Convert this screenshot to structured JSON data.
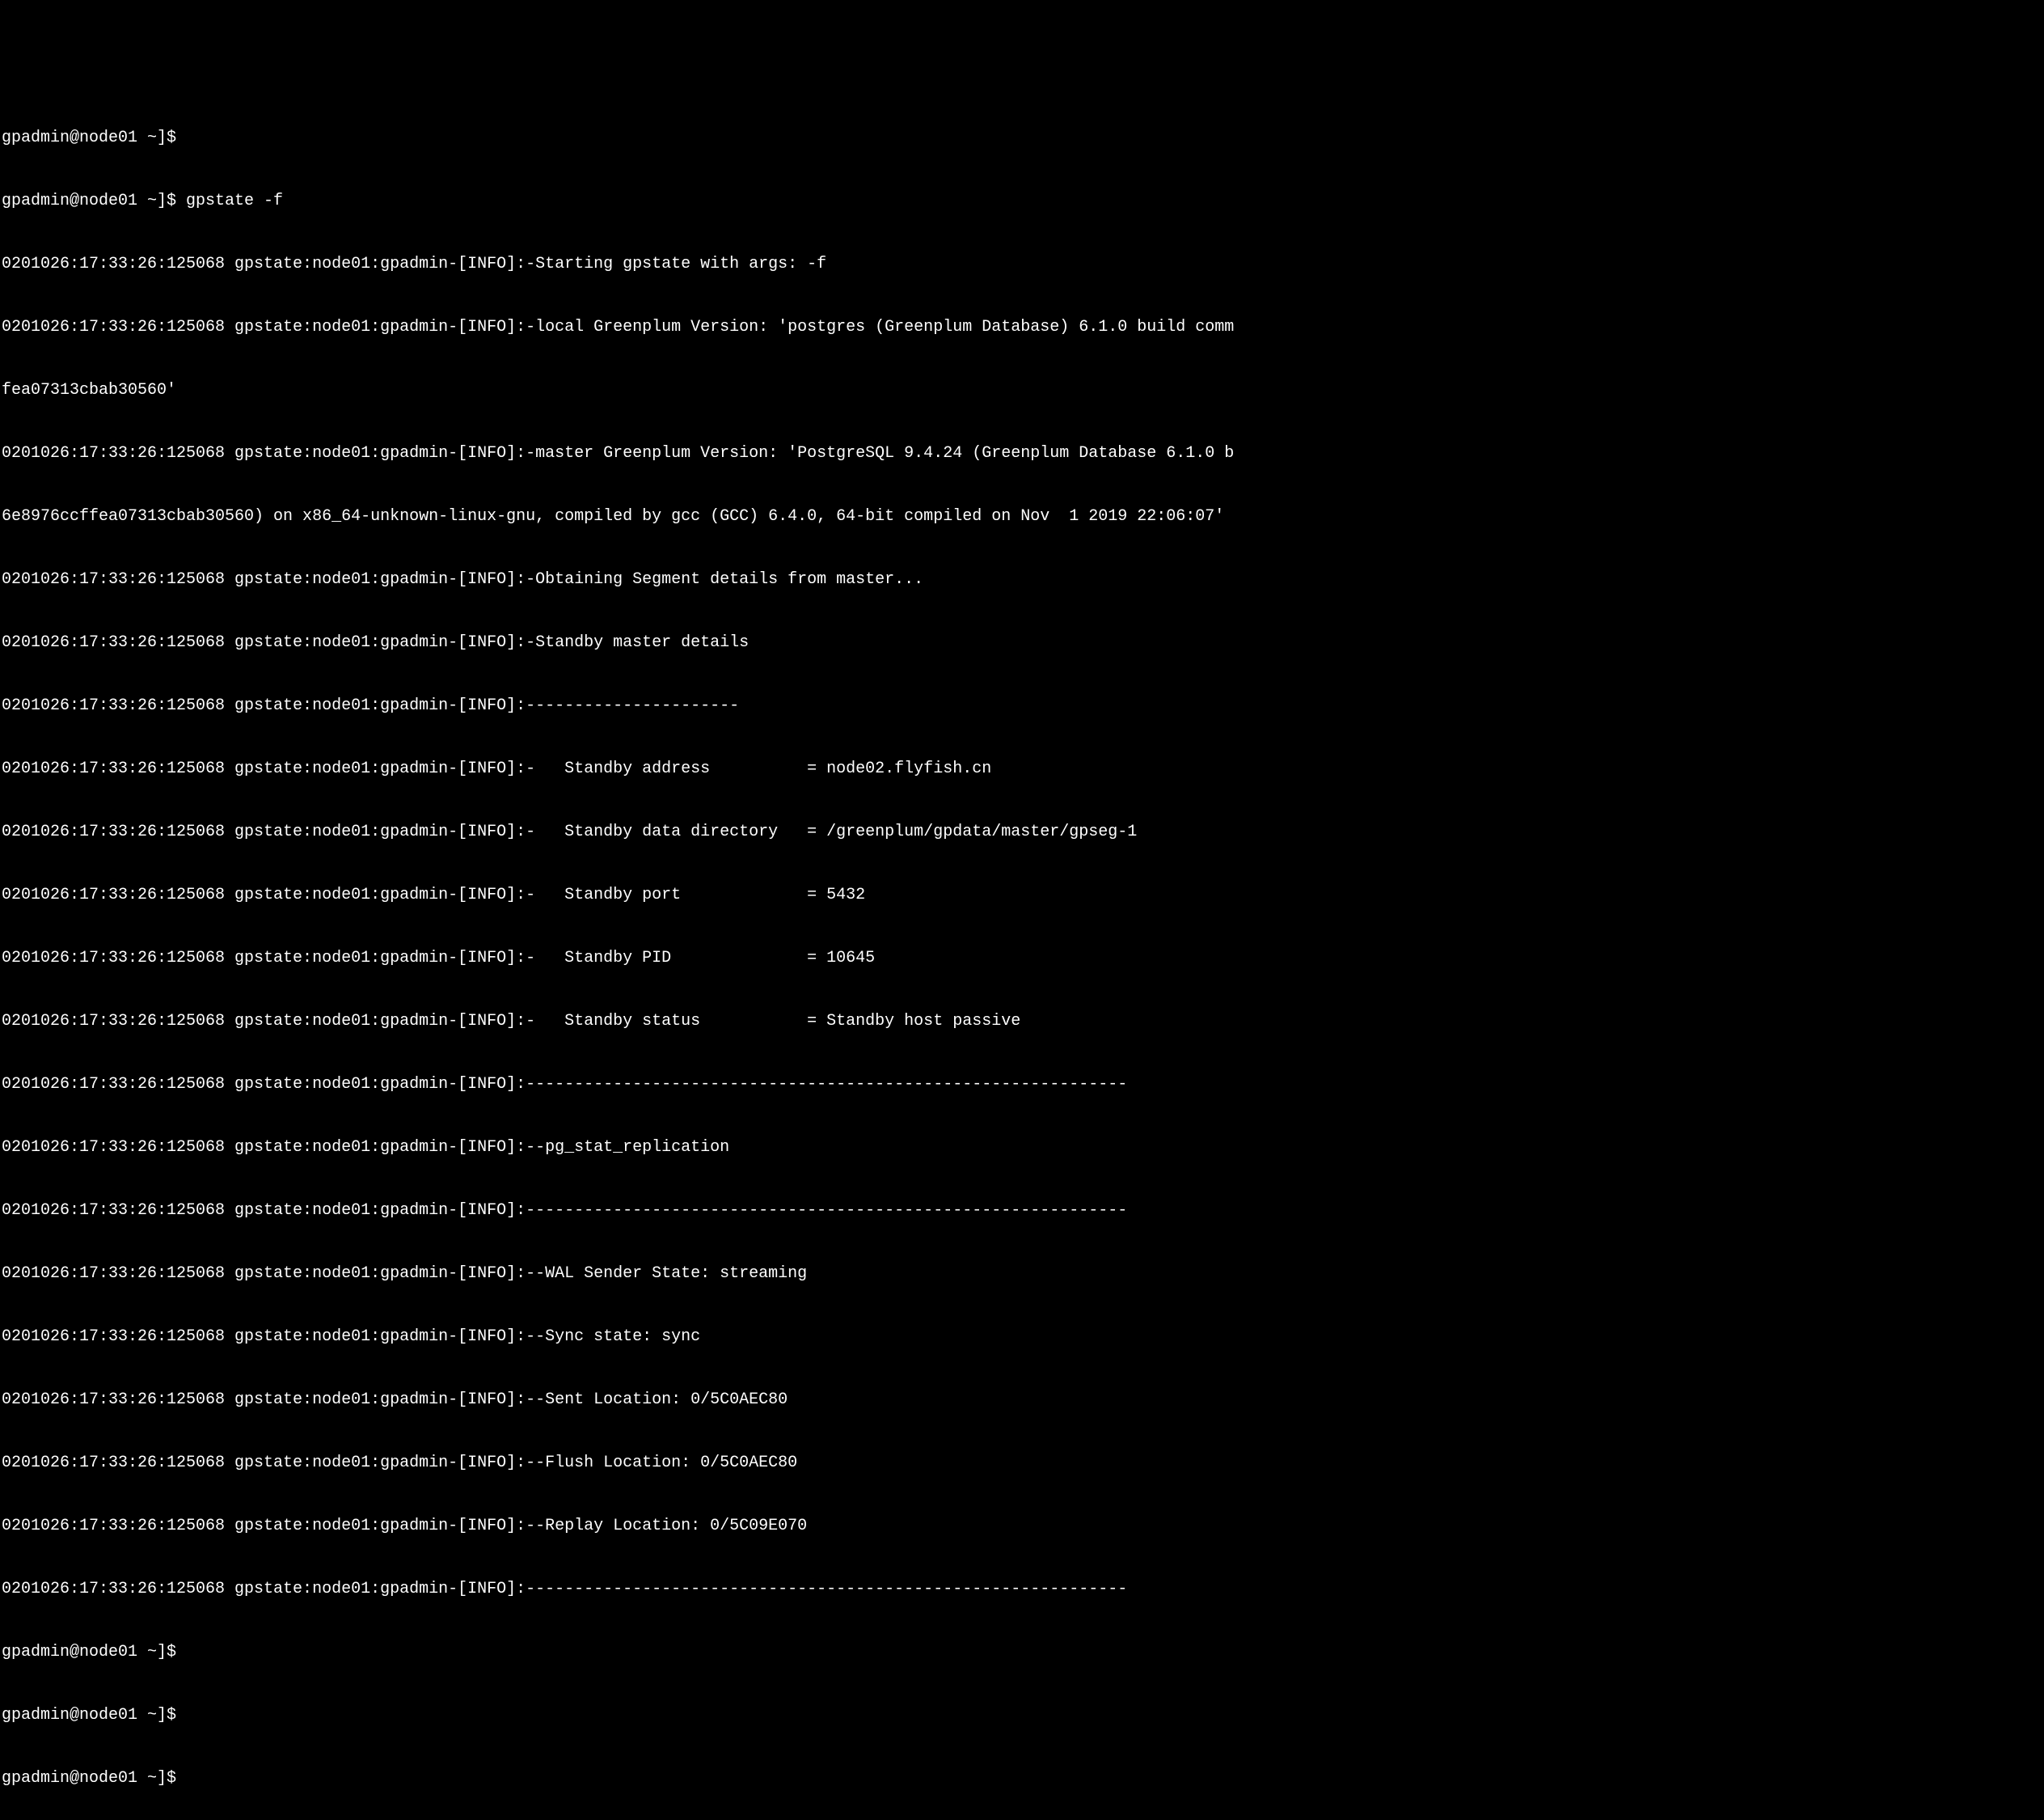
{
  "terminal": {
    "lines": [
      "gpadmin@node01 ~]$",
      "gpadmin@node01 ~]$ gpstate -f",
      "0201026:17:33:26:125068 gpstate:node01:gpadmin-[INFO]:-Starting gpstate with args: -f",
      "0201026:17:33:26:125068 gpstate:node01:gpadmin-[INFO]:-local Greenplum Version: 'postgres (Greenplum Database) 6.1.0 build comm",
      "fea07313cbab30560'",
      "0201026:17:33:26:125068 gpstate:node01:gpadmin-[INFO]:-master Greenplum Version: 'PostgreSQL 9.4.24 (Greenplum Database 6.1.0 b",
      "6e8976ccffea07313cbab30560) on x86_64-unknown-linux-gnu, compiled by gcc (GCC) 6.4.0, 64-bit compiled on Nov  1 2019 22:06:07'",
      "0201026:17:33:26:125068 gpstate:node01:gpadmin-[INFO]:-Obtaining Segment details from master...",
      "0201026:17:33:26:125068 gpstate:node01:gpadmin-[INFO]:-Standby master details",
      "0201026:17:33:26:125068 gpstate:node01:gpadmin-[INFO]:----------------------",
      "0201026:17:33:26:125068 gpstate:node01:gpadmin-[INFO]:-   Standby address          = node02.flyfish.cn",
      "0201026:17:33:26:125068 gpstate:node01:gpadmin-[INFO]:-   Standby data directory   = /greenplum/gpdata/master/gpseg-1",
      "0201026:17:33:26:125068 gpstate:node01:gpadmin-[INFO]:-   Standby port             = 5432",
      "0201026:17:33:26:125068 gpstate:node01:gpadmin-[INFO]:-   Standby PID              = 10645",
      "0201026:17:33:26:125068 gpstate:node01:gpadmin-[INFO]:-   Standby status           = Standby host passive",
      "0201026:17:33:26:125068 gpstate:node01:gpadmin-[INFO]:--------------------------------------------------------------",
      "0201026:17:33:26:125068 gpstate:node01:gpadmin-[INFO]:--pg_stat_replication",
      "0201026:17:33:26:125068 gpstate:node01:gpadmin-[INFO]:--------------------------------------------------------------",
      "0201026:17:33:26:125068 gpstate:node01:gpadmin-[INFO]:--WAL Sender State: streaming",
      "0201026:17:33:26:125068 gpstate:node01:gpadmin-[INFO]:--Sync state: sync",
      "0201026:17:33:26:125068 gpstate:node01:gpadmin-[INFO]:--Sent Location: 0/5C0AEC80",
      "0201026:17:33:26:125068 gpstate:node01:gpadmin-[INFO]:--Flush Location: 0/5C0AEC80",
      "0201026:17:33:26:125068 gpstate:node01:gpadmin-[INFO]:--Replay Location: 0/5C09E070",
      "0201026:17:33:26:125068 gpstate:node01:gpadmin-[INFO]:--------------------------------------------------------------",
      "gpadmin@node01 ~]$",
      "gpadmin@node01 ~]$",
      "gpadmin@node01 ~]$"
    ]
  }
}
